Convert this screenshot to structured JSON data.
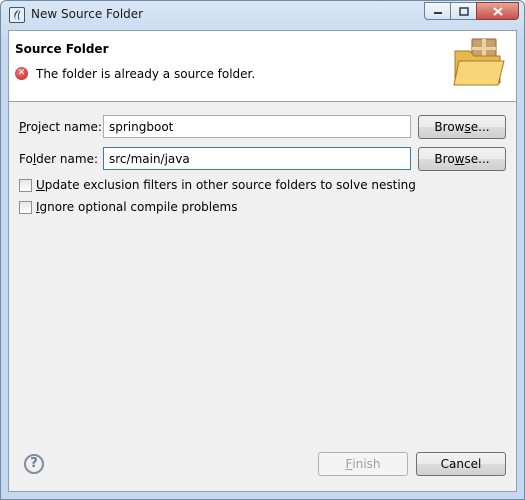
{
  "window": {
    "title": "New Source Folder",
    "icons": {
      "app": "eclipse-icon",
      "minimize": "minimize-icon",
      "maximize": "maximize-icon",
      "close": "close-icon"
    }
  },
  "header": {
    "title": "Source Folder",
    "message": "The folder is already a source folder.",
    "message_icon": "error-icon",
    "banner_icon": "folder-package-icon"
  },
  "form": {
    "project": {
      "label_pre": "",
      "label_mnemonic": "P",
      "label_post": "roject name:",
      "value": "springboot",
      "browse_pre": "Brow",
      "browse_mnemonic": "s",
      "browse_post": "e..."
    },
    "folder": {
      "label_pre": "Fo",
      "label_mnemonic": "l",
      "label_post": "der name:",
      "value": "src/main/java",
      "browse_pre": "Bro",
      "browse_mnemonic": "w",
      "browse_post": "se..."
    },
    "options": [
      {
        "mnemonic": "U",
        "label": "pdate exclusion filters in other source folders to solve nesting",
        "checked": false
      },
      {
        "mnemonic": "I",
        "label": "gnore optional compile problems",
        "checked": false
      }
    ]
  },
  "footer": {
    "help_icon": "help-icon",
    "help_glyph": "?",
    "finish_mnemonic": "F",
    "finish_post": "inish",
    "cancel_label": "Cancel"
  },
  "colors": {
    "titlebar": "#c6d9ef",
    "client": "#f0f0f0",
    "error": "#c41e1e",
    "focus_border": "#3d7bad"
  }
}
